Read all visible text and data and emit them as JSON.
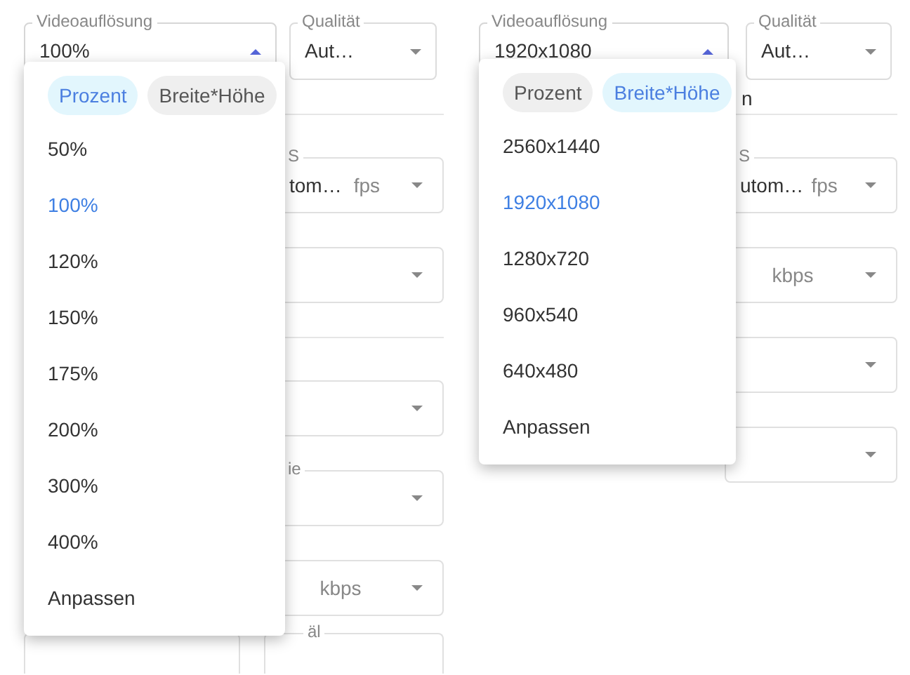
{
  "panels": [
    {
      "resolution": {
        "label": "Videoauflösung",
        "value": "100%",
        "expanded": true
      },
      "quality": {
        "label": "Qualität",
        "value": "Aut…",
        "expanded": false
      },
      "menu": {
        "modes": [
          {
            "label": "Prozent",
            "selected": true
          },
          {
            "label": "Breite*Höhe",
            "selected": false
          }
        ],
        "options": [
          {
            "label": "50%",
            "selected": false
          },
          {
            "label": "100%",
            "selected": true
          },
          {
            "label": "120%",
            "selected": false
          },
          {
            "label": "150%",
            "selected": false
          },
          {
            "label": "175%",
            "selected": false
          },
          {
            "label": "200%",
            "selected": false
          },
          {
            "label": "300%",
            "selected": false
          },
          {
            "label": "400%",
            "selected": false
          },
          {
            "label": "Anpassen",
            "selected": false
          }
        ]
      },
      "background": [
        {
          "kind": "divider"
        },
        {
          "kind": "field",
          "label": "S",
          "value": "tom…",
          "unit": "fps"
        },
        {
          "kind": "field"
        },
        {
          "kind": "divider"
        },
        {
          "kind": "field"
        },
        {
          "kind": "field",
          "label": "ie"
        },
        {
          "kind": "field",
          "unit": "kbps"
        },
        {
          "kind": "pair",
          "label": "äl"
        }
      ]
    },
    {
      "resolution": {
        "label": "Videoauflösung",
        "value": "1920x1080",
        "expanded": true
      },
      "quality": {
        "label": "Qualität",
        "value": "Aut…",
        "expanded": false
      },
      "menu": {
        "modes": [
          {
            "label": "Prozent",
            "selected": false
          },
          {
            "label": "Breite*Höhe",
            "selected": true
          }
        ],
        "options": [
          {
            "label": "2560x1440",
            "selected": false
          },
          {
            "label": "1920x1080",
            "selected": true
          },
          {
            "label": "1280x720",
            "selected": false
          },
          {
            "label": "960x540",
            "selected": false
          },
          {
            "label": "640x480",
            "selected": false
          },
          {
            "label": "Anpassen",
            "selected": false
          }
        ]
      },
      "background": [
        {
          "kind": "divider",
          "label": "n"
        },
        {
          "kind": "field",
          "label": "S",
          "value": "utom…",
          "unit": "fps"
        },
        {
          "kind": "field",
          "unit": "kbps"
        },
        {
          "kind": "field"
        },
        {
          "kind": "field"
        }
      ]
    }
  ]
}
